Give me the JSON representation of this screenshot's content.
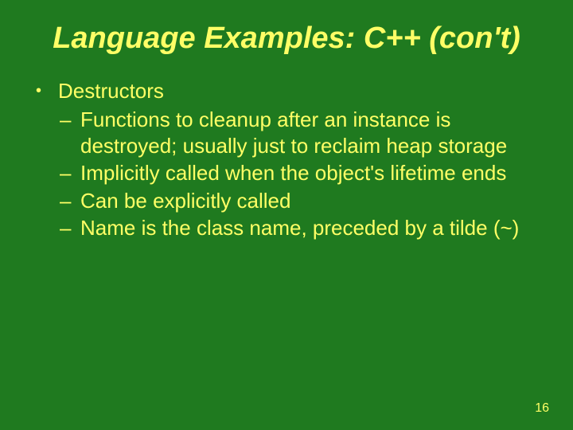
{
  "title": "Language Examples: C++ (con't)",
  "heading": "Destructors",
  "items": [
    "Functions to cleanup after an instance is destroyed; usually just to reclaim heap storage",
    "Implicitly called when the object's lifetime ends",
    "Can be explicitly called",
    "Name is the class name, preceded by a tilde (~)"
  ],
  "page_number": "16"
}
